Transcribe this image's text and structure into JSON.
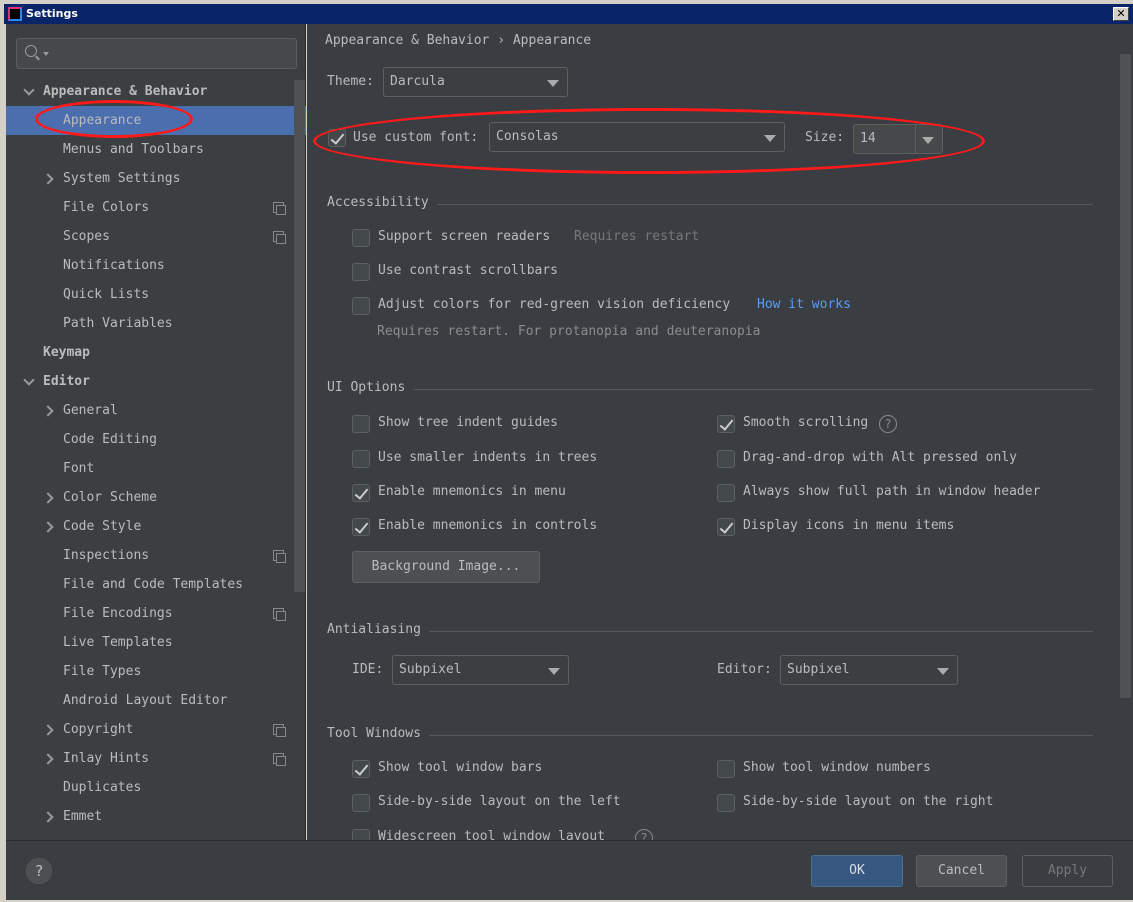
{
  "window": {
    "title": "Settings",
    "close": "✕"
  },
  "search": {
    "placeholder": ""
  },
  "sidebar": {
    "items": [
      {
        "label": "Appearance & Behavior",
        "level": 0,
        "chevron": "down"
      },
      {
        "label": "Appearance",
        "level": 1,
        "selected": true
      },
      {
        "label": "Menus and Toolbars",
        "level": 1
      },
      {
        "label": "System Settings",
        "level": 1,
        "chevron": "right"
      },
      {
        "label": "File Colors",
        "level": 1,
        "copy": true
      },
      {
        "label": "Scopes",
        "level": 1,
        "copy": true
      },
      {
        "label": "Notifications",
        "level": 1
      },
      {
        "label": "Quick Lists",
        "level": 1
      },
      {
        "label": "Path Variables",
        "level": 1
      },
      {
        "label": "Keymap",
        "level": 0
      },
      {
        "label": "Editor",
        "level": 0,
        "chevron": "down"
      },
      {
        "label": "General",
        "level": 1,
        "chevron": "right"
      },
      {
        "label": "Code Editing",
        "level": 1
      },
      {
        "label": "Font",
        "level": 1
      },
      {
        "label": "Color Scheme",
        "level": 1,
        "chevron": "right"
      },
      {
        "label": "Code Style",
        "level": 1,
        "chevron": "right"
      },
      {
        "label": "Inspections",
        "level": 1,
        "copy": true
      },
      {
        "label": "File and Code Templates",
        "level": 1
      },
      {
        "label": "File Encodings",
        "level": 1,
        "copy": true
      },
      {
        "label": "Live Templates",
        "level": 1
      },
      {
        "label": "File Types",
        "level": 1
      },
      {
        "label": "Android Layout Editor",
        "level": 1
      },
      {
        "label": "Copyright",
        "level": 1,
        "chevron": "right",
        "copy": true
      },
      {
        "label": "Inlay Hints",
        "level": 1,
        "chevron": "right",
        "copy": true
      },
      {
        "label": "Duplicates",
        "level": 1
      },
      {
        "label": "Emmet",
        "level": 1,
        "chevron": "right"
      }
    ]
  },
  "breadcrumb": {
    "parent": "Appearance & Behavior",
    "sep": "›",
    "current": "Appearance"
  },
  "theme": {
    "label": "Theme:",
    "value": "Darcula"
  },
  "custom_font": {
    "label": "Use custom font:",
    "checked": true,
    "value": "Consolas",
    "size_label": "Size:",
    "size": "14"
  },
  "accessibility": {
    "title": "Accessibility",
    "screen_readers": {
      "label": "Support screen readers",
      "checked": false,
      "note": "Requires restart"
    },
    "contrast_scrollbars": {
      "label": "Use contrast scrollbars",
      "checked": false
    },
    "red_green": {
      "label": "Adjust colors for red-green vision deficiency",
      "checked": false,
      "link": "How it works",
      "note": "Requires restart. For protanopia and deuteranopia"
    }
  },
  "ui_options": {
    "title": "UI Options",
    "left": [
      {
        "label": "Show tree indent guides",
        "checked": false
      },
      {
        "label": "Use smaller indents in trees",
        "checked": false
      },
      {
        "label": "Enable mnemonics in menu",
        "checked": true
      },
      {
        "label": "Enable mnemonics in controls",
        "checked": true
      }
    ],
    "right": [
      {
        "label": "Smooth scrolling",
        "checked": true
      },
      {
        "label": "Drag-and-drop with Alt pressed only",
        "checked": false
      },
      {
        "label": "Always show full path in window header",
        "checked": false
      },
      {
        "label": "Display icons in menu items",
        "checked": true
      }
    ],
    "background_button": "Background Image..."
  },
  "antialiasing": {
    "title": "Antialiasing",
    "ide_label": "IDE:",
    "ide_value": "Subpixel",
    "editor_label": "Editor:",
    "editor_value": "Subpixel"
  },
  "tool_windows": {
    "title": "Tool Windows",
    "items": [
      {
        "label": "Show tool window bars",
        "checked": true
      },
      {
        "label": "Show tool window numbers",
        "checked": false
      },
      {
        "label": "Side-by-side layout on the left",
        "checked": false
      },
      {
        "label": "Side-by-side layout on the right",
        "checked": false
      },
      {
        "label": "Widescreen tool window layout",
        "checked": false
      }
    ]
  },
  "footer": {
    "help": "?",
    "ok": "OK",
    "cancel": "Cancel",
    "apply": "Apply"
  },
  "colors": {
    "selection": "#4b6eaf",
    "link": "#589df6",
    "annotation": "#ff1a1a"
  }
}
